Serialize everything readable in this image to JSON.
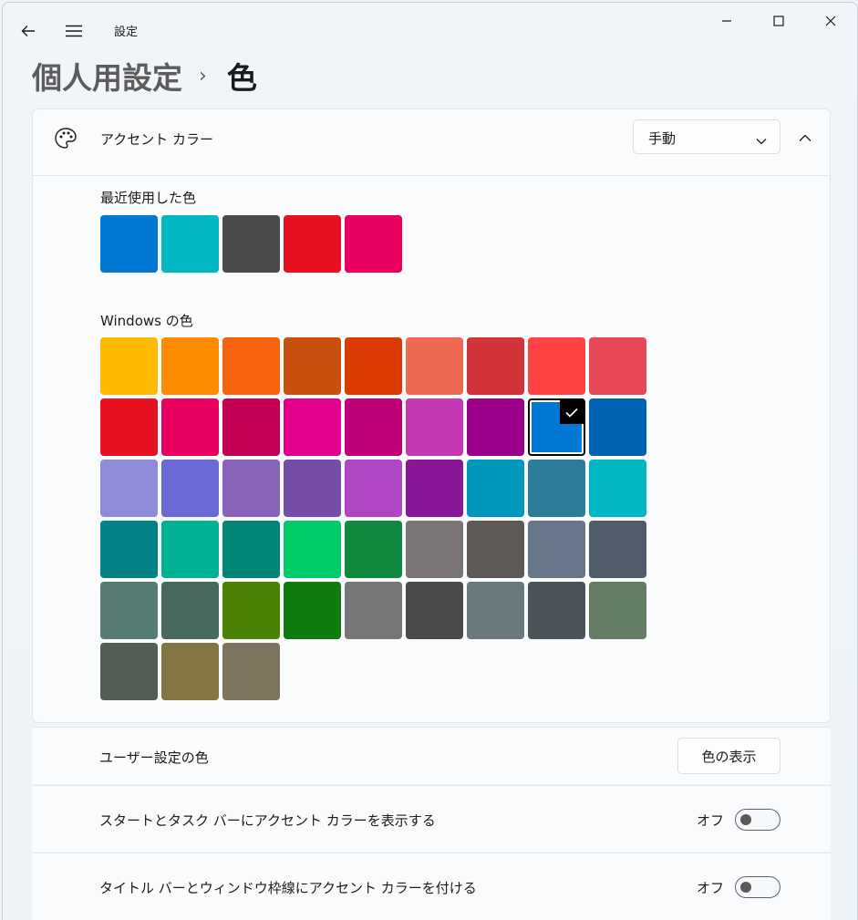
{
  "window": {
    "app_title": "設定",
    "back_icon": "back-arrow-icon",
    "menu_icon": "hamburger-menu-icon",
    "controls": [
      "minimize-icon",
      "maximize-icon",
      "close-icon"
    ]
  },
  "breadcrumb": {
    "parent": "個人用設定",
    "separator": "›",
    "current": "色"
  },
  "accent": {
    "label": "アクセント カラー",
    "icon": "palette-icon",
    "mode_value": "手動",
    "recent_label": "最近使用した色",
    "recent_colors": [
      "#0078d4",
      "#00b7c3",
      "#4c4a48",
      "#e81123",
      "#ea005e"
    ],
    "windows_label": "Windows の色",
    "selected_index": 16,
    "windows_colors": [
      "#ffb900",
      "#ff8c00",
      "#f7630c",
      "#ca5010",
      "#da3b01",
      "#ef6950",
      "#d13438",
      "#ff4343",
      "#e74856",
      "#e81123",
      "#ea005e",
      "#c30052",
      "#e3008c",
      "#bf0077",
      "#c239b3",
      "#9a0089",
      "#0078d4",
      "#0063b1",
      "#8e8cd8",
      "#6b69d6",
      "#8764b8",
      "#744da9",
      "#b146c2",
      "#881798",
      "#0099bc",
      "#2d7d9a",
      "#00b7c3",
      "#038387",
      "#00b294",
      "#018574",
      "#00cc6a",
      "#10893e",
      "#7a7574",
      "#5d5a58",
      "#68768a",
      "#515c6b",
      "#567c73",
      "#486860",
      "#498205",
      "#107c10",
      "#767676",
      "#4c4a48",
      "#69797e",
      "#4a5459",
      "#647c64",
      "#525e54",
      "#847545",
      "#7e735f"
    ]
  },
  "custom_color": {
    "label": "ユーザー設定の色",
    "button": "色の表示"
  },
  "start_taskbar": {
    "label": "スタートとタスク バーにアクセント カラーを表示する",
    "state": "オフ"
  },
  "title_bars": {
    "label": "タイトル バーとウィンドウ枠線にアクセント カラーを付ける",
    "state": "オフ"
  }
}
